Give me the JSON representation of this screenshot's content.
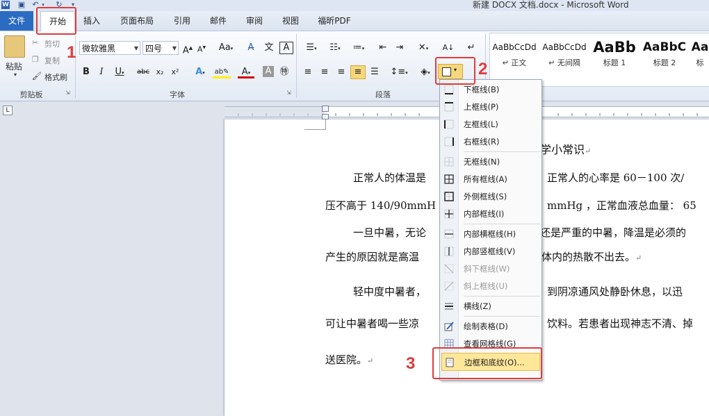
{
  "window": {
    "title": "新建 DOCX 文档.docx - Microsoft Word"
  },
  "tabs": [
    {
      "id": "file",
      "label": "文件"
    },
    {
      "id": "home",
      "label": "开始"
    },
    {
      "id": "insert",
      "label": "插入"
    },
    {
      "id": "layout",
      "label": "页面布局"
    },
    {
      "id": "references",
      "label": "引用"
    },
    {
      "id": "mailings",
      "label": "邮件"
    },
    {
      "id": "review",
      "label": "审阅"
    },
    {
      "id": "view",
      "label": "视图"
    },
    {
      "id": "foxit",
      "label": "福昕PDF"
    }
  ],
  "clipboard": {
    "paste": "粘贴",
    "cut": "剪切",
    "copy": "复制",
    "format_painter": "格式刷",
    "group": "剪贴板"
  },
  "font": {
    "name": "微软雅黑",
    "size": "四号",
    "group": "字体"
  },
  "paragraph": {
    "group": "段落"
  },
  "styles": [
    {
      "sample": "AaBbCcDd",
      "name": "↵ 正文"
    },
    {
      "sample": "AaBbCcDd",
      "name": "↵ 无间隔"
    },
    {
      "sample": "AaBb",
      "name": "标题 1"
    },
    {
      "sample": "AaBbC",
      "name": "标题 2"
    },
    {
      "sample": "Aa",
      "name": "标"
    }
  ],
  "document": {
    "lines": [
      "学小常识",
      "正常人的体温是",
      "正常人的心率是 60－100 次/",
      "压不高于 140/90mmH",
      "mmHg ，正常血液总血量：  65",
      "一旦中暑，无论",
      "还是严重的中暑，降温是必须的",
      "产生的原因就是高温",
      "体内的热散不出去。",
      "轻中度中暑者，",
      "到阴凉通风处静卧休息，以迅",
      "可让中暑者喝一些凉",
      "饮料。若患者出现神志不清、掉",
      "送医院。"
    ],
    "paragraph_mark": "↵"
  },
  "border_menu": {
    "items": [
      {
        "label": "下框线(B)",
        "disabled": false
      },
      {
        "label": "上框线(P)",
        "disabled": false
      },
      {
        "label": "左框线(L)",
        "disabled": false
      },
      {
        "label": "右框线(R)",
        "disabled": false
      },
      {
        "label": "无框线(N)",
        "disabled": false
      },
      {
        "label": "所有框线(A)",
        "disabled": false
      },
      {
        "label": "外侧框线(S)",
        "disabled": false
      },
      {
        "label": "内部框线(I)",
        "disabled": false
      },
      {
        "label": "内部横框线(H)",
        "disabled": false
      },
      {
        "label": "内部竖框线(V)",
        "disabled": false
      },
      {
        "label": "斜下框线(W)",
        "disabled": true
      },
      {
        "label": "斜上框线(U)",
        "disabled": true
      },
      {
        "label": "横线(Z)",
        "disabled": false
      },
      {
        "label": "绘制表格(D)",
        "disabled": false
      },
      {
        "label": "查看网格线(G)",
        "disabled": false
      },
      {
        "label": "边框和底纹(O)...",
        "disabled": false
      }
    ]
  },
  "annotations": {
    "step1": "1",
    "step2": "2",
    "step3": "3"
  },
  "colors": {
    "annotation_red": "#e03b3b",
    "file_tab_blue": "#2b6bc2",
    "highlight_yellow": "#ffe79a"
  }
}
